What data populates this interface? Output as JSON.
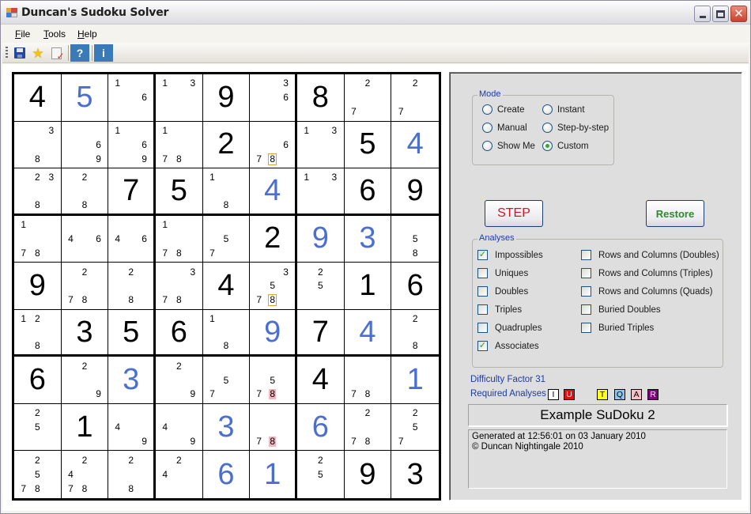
{
  "window": {
    "title": "Duncan's Sudoku Solver",
    "controls": {
      "minimize": "minimize",
      "maximize": "maximize",
      "close": "close"
    }
  },
  "menu": [
    {
      "label": "File",
      "mnemonic": "F",
      "rest": "ile"
    },
    {
      "label": "Tools",
      "mnemonic": "T",
      "rest": "ools"
    },
    {
      "label": "Help",
      "mnemonic": "H",
      "rest": "elp"
    }
  ],
  "toolbar": {
    "buttons": [
      {
        "name": "save",
        "icon": "floppy-disk-icon"
      },
      {
        "name": "favourite",
        "icon": "star-icon"
      },
      {
        "name": "check-document",
        "icon": "document-check-icon"
      },
      {
        "name": "help",
        "icon": "question-icon",
        "label": "?"
      },
      {
        "name": "info",
        "icon": "info-icon",
        "label": "i"
      }
    ]
  },
  "colors": {
    "solved_digit": "#4a6fd0",
    "given_digit": "#000000",
    "highlight_box": "#d9a52a",
    "highlight_pink": "#f2b6c0",
    "group_legend": "#1c3ca8",
    "step_text": "#d41426",
    "restore_text": "#2c8a2c"
  },
  "grid": [
    [
      {
        "v": 4,
        "t": "given"
      },
      {
        "v": 5,
        "t": "solved"
      },
      {
        "c": [
          1,
          6
        ]
      },
      {
        "c": [
          1,
          3
        ]
      },
      {
        "v": 9,
        "t": "given"
      },
      {
        "c": [
          3,
          6
        ]
      },
      {
        "v": 8,
        "t": "given"
      },
      {
        "c": [
          2,
          7
        ]
      },
      {
        "c": [
          2,
          7
        ]
      }
    ],
    [
      {
        "c": [
          3,
          8
        ]
      },
      {
        "c": [
          6,
          9
        ]
      },
      {
        "c": [
          1,
          6,
          9
        ]
      },
      {
        "c": [
          1,
          7,
          8
        ]
      },
      {
        "v": 2,
        "t": "given"
      },
      {
        "c": [
          6,
          7,
          8
        ],
        "box": [
          8
        ]
      },
      {
        "c": [
          1,
          3
        ]
      },
      {
        "v": 5,
        "t": "given"
      },
      {
        "v": 4,
        "t": "solved"
      }
    ],
    [
      {
        "c": [
          2,
          3,
          8
        ]
      },
      {
        "c": [
          2,
          8
        ]
      },
      {
        "v": 7,
        "t": "given"
      },
      {
        "v": 5,
        "t": "given"
      },
      {
        "c": [
          1,
          8
        ]
      },
      {
        "v": 4,
        "t": "solved"
      },
      {
        "c": [
          1,
          3
        ]
      },
      {
        "v": 6,
        "t": "given"
      },
      {
        "v": 9,
        "t": "given"
      }
    ],
    [
      {
        "c": [
          1,
          7,
          8
        ]
      },
      {
        "c": [
          4,
          6
        ]
      },
      {
        "c": [
          4,
          6
        ]
      },
      {
        "c": [
          1,
          7,
          8
        ]
      },
      {
        "c": [
          5,
          7
        ]
      },
      {
        "v": 2,
        "t": "given"
      },
      {
        "v": 9,
        "t": "solved"
      },
      {
        "v": 3,
        "t": "solved"
      },
      {
        "c": [
          5,
          8
        ]
      }
    ],
    [
      {
        "v": 9,
        "t": "given"
      },
      {
        "c": [
          2,
          7,
          8
        ]
      },
      {
        "c": [
          2,
          8
        ]
      },
      {
        "c": [
          3,
          7,
          8
        ]
      },
      {
        "v": 4,
        "t": "given"
      },
      {
        "c": [
          3,
          5,
          7,
          8
        ],
        "box": [
          8
        ]
      },
      {
        "c": [
          2,
          5
        ]
      },
      {
        "v": 1,
        "t": "given"
      },
      {
        "v": 6,
        "t": "given"
      }
    ],
    [
      {
        "c": [
          1,
          2,
          8
        ]
      },
      {
        "v": 3,
        "t": "given"
      },
      {
        "v": 5,
        "t": "given"
      },
      {
        "v": 6,
        "t": "given"
      },
      {
        "c": [
          1,
          8
        ]
      },
      {
        "v": 9,
        "t": "solved"
      },
      {
        "v": 7,
        "t": "given"
      },
      {
        "v": 4,
        "t": "solved"
      },
      {
        "c": [
          2,
          8
        ]
      }
    ],
    [
      {
        "v": 6,
        "t": "given"
      },
      {
        "c": [
          2,
          9
        ]
      },
      {
        "v": 3,
        "t": "solved"
      },
      {
        "c": [
          2,
          9
        ]
      },
      {
        "c": [
          5,
          7
        ]
      },
      {
        "c": [
          5,
          7,
          8
        ],
        "pink": [
          8
        ]
      },
      {
        "v": 4,
        "t": "given"
      },
      {
        "c": [
          7,
          8
        ]
      },
      {
        "v": 1,
        "t": "solved"
      }
    ],
    [
      {
        "c": [
          2,
          5
        ]
      },
      {
        "v": 1,
        "t": "given"
      },
      {
        "c": [
          4,
          9
        ]
      },
      {
        "c": [
          4,
          9
        ]
      },
      {
        "v": 3,
        "t": "solved"
      },
      {
        "c": [
          7,
          8
        ],
        "pink": [
          8
        ]
      },
      {
        "v": 6,
        "t": "solved"
      },
      {
        "c": [
          2,
          7,
          8
        ]
      },
      {
        "c": [
          2,
          5,
          7
        ]
      }
    ],
    [
      {
        "c": [
          2,
          5,
          7,
          8
        ]
      },
      {
        "c": [
          2,
          4,
          7,
          8
        ]
      },
      {
        "c": [
          2,
          8
        ]
      },
      {
        "c": [
          2,
          4
        ]
      },
      {
        "v": 6,
        "t": "solved"
      },
      {
        "v": 1,
        "t": "solved"
      },
      {
        "c": [
          2,
          5
        ]
      },
      {
        "v": 9,
        "t": "given"
      },
      {
        "v": 3,
        "t": "given"
      }
    ]
  ],
  "panel": {
    "mode": {
      "legend": "Mode",
      "options": [
        {
          "label": "Create",
          "selected": false
        },
        {
          "label": "Manual",
          "selected": false
        },
        {
          "label": "Show Me",
          "selected": false
        },
        {
          "label": "Instant",
          "selected": false
        },
        {
          "label": "Step-by-step",
          "selected": false
        },
        {
          "label": "Custom",
          "selected": true
        }
      ]
    },
    "step_label": "STEP",
    "restore_label": "Restore",
    "analyses": {
      "legend": "Analyses",
      "left": [
        {
          "label": "Impossibles",
          "checked": true
        },
        {
          "label": "Uniques",
          "checked": false
        },
        {
          "label": "Doubles",
          "checked": false
        },
        {
          "label": "Triples",
          "checked": false
        },
        {
          "label": "Quadruples",
          "checked": false
        },
        {
          "label": "Associates",
          "checked": true
        }
      ],
      "right": [
        {
          "label": "Rows and Columns (Doubles)",
          "checked": false
        },
        {
          "label": "Rows and Columns (Triples)",
          "checked": false
        },
        {
          "label": "Rows and Columns (Quads)",
          "checked": false
        },
        {
          "label": "Buried Doubles",
          "checked": false
        },
        {
          "label": "Buried Triples",
          "checked": false
        }
      ]
    },
    "difficulty": "Difficulty Factor 31",
    "required_label": "Required Analyses",
    "required_badges": [
      {
        "letter": "I",
        "bg": "#ffffff",
        "fg": "#000000"
      },
      {
        "letter": "U",
        "bg": "#e01010",
        "fg": "#ffffff"
      },
      {
        "letter": "T",
        "bg": "#ffff20",
        "fg": "#000000"
      },
      {
        "letter": "Q",
        "bg": "#8ec8f0",
        "fg": "#000000"
      },
      {
        "letter": "A",
        "bg": "#f6c0c8",
        "fg": "#000000"
      },
      {
        "letter": "R",
        "bg": "#800080",
        "fg": "#ffffff"
      }
    ],
    "puzzle_title": "Example SuDoku 2",
    "info_lines": [
      "Generated at 12:56:01 on 03 January 2010",
      "© Duncan Nightingale 2010"
    ]
  }
}
